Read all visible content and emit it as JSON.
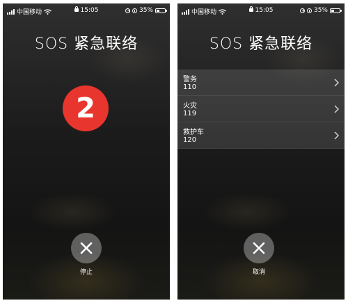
{
  "status_bar": {
    "carrier": "中国移动",
    "time": "15:05",
    "battery": "35%",
    "battery_level": 0.35
  },
  "left_screen": {
    "title": "SOS 紧急联络",
    "countdown": "2",
    "stop_label": "停止"
  },
  "right_screen": {
    "title": "SOS 紧急联络",
    "contacts": [
      {
        "name": "警务",
        "number": "110"
      },
      {
        "name": "火灾",
        "number": "119"
      },
      {
        "name": "救护车",
        "number": "120"
      }
    ],
    "cancel_label": "取消"
  },
  "colors": {
    "countdown_red": "#e8352d",
    "text": "#ffffff"
  }
}
